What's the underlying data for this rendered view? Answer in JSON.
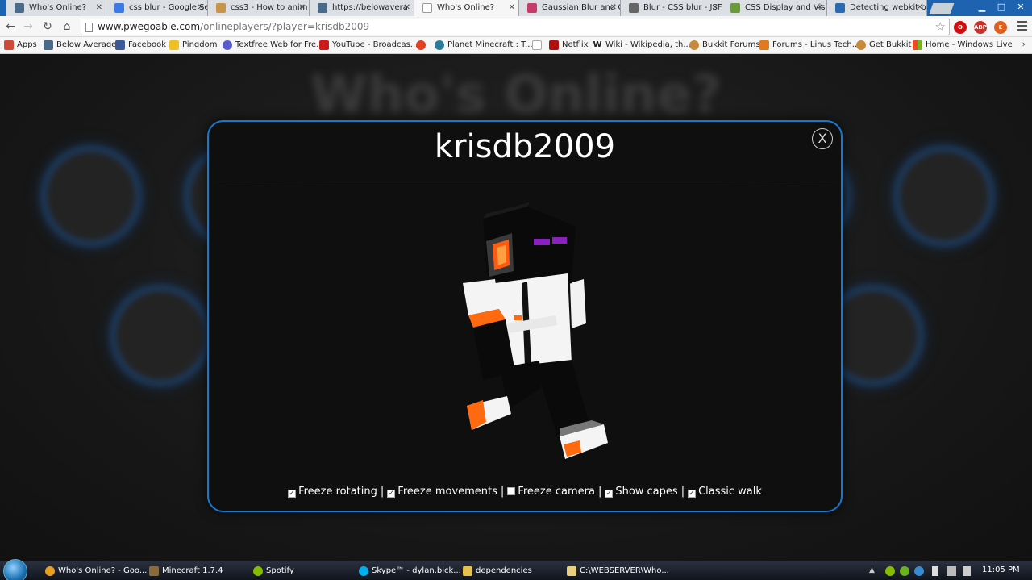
{
  "browser": {
    "tabs": [
      {
        "title": "Who's Online?",
        "color": "#4a6a8a"
      },
      {
        "title": "css blur - Google Se",
        "color": "#3b7be8"
      },
      {
        "title": "css3 - How to anim",
        "color": "#c8944a"
      },
      {
        "title": "https://belowavera",
        "color": "#4a6a8a"
      },
      {
        "title": "Who's Online?",
        "color": "#ffffff",
        "active": true
      },
      {
        "title": "Gaussian Blur and C",
        "color": "#c83a6a"
      },
      {
        "title": "Blur - CSS blur - JSF",
        "color": "#666666"
      },
      {
        "title": "CSS Display and Visi",
        "color": "#6a9a3a"
      },
      {
        "title": "Detecting webkit br",
        "color": "#2a6ab0"
      }
    ],
    "url_host": "www.pwegoable.com",
    "url_path": "/onlineplayers/?player=krisdb2009",
    "window_controls": {
      "minimize": "▁",
      "maximize": "□",
      "close": "✕"
    },
    "extensions": [
      "O",
      "ABP",
      "E"
    ]
  },
  "bookmarks": [
    {
      "label": "Apps",
      "color": "#d04a3a"
    },
    {
      "label": "Below Average",
      "color": "#4a6a8a"
    },
    {
      "label": "Facebook",
      "color": "#3b5998"
    },
    {
      "label": "Pingdom",
      "color": "#f0c020"
    },
    {
      "label": "Textfree Web for Fre...",
      "color": "#5a5ad0"
    },
    {
      "label": "YouTube - Broadcas...",
      "color": "#cc1a1a"
    },
    {
      "label": "",
      "color": "#e04020"
    },
    {
      "label": "Planet Minecraft : T...",
      "color": "#2a7a9a"
    },
    {
      "label": "",
      "color": "#dddddd"
    },
    {
      "label": "Netflix",
      "color": "#b01010"
    },
    {
      "label": "Wiki - Wikipedia, th...",
      "color": "#ffffff"
    },
    {
      "label": "Bukkit Forums",
      "color": "#c88a3a"
    },
    {
      "label": "Forums - Linus Tech...",
      "color": "#e07a20"
    },
    {
      "label": "Get Bukkit",
      "color": "#c88a3a"
    },
    {
      "label": "Home - Windows Live",
      "color": "#f0a020"
    }
  ],
  "page": {
    "background_title": "Who's Online?",
    "modal": {
      "player_name": "krisdb2009",
      "close_label": "X",
      "options": [
        {
          "label": "Freeze rotating",
          "checked": true
        },
        {
          "label": "Freeze movements",
          "checked": true
        },
        {
          "label": "Freeze camera",
          "checked": false
        },
        {
          "label": "Show capes",
          "checked": true
        },
        {
          "label": "Classic walk",
          "checked": true
        }
      ]
    },
    "accent_color": "#1878d0"
  },
  "taskbar": {
    "items": [
      {
        "label": "Who's Online? - Goo...",
        "color": "#e8a020"
      },
      {
        "label": "Minecraft 1.7.4",
        "color": "#8a6a3a"
      },
      {
        "label": "Spotify",
        "color": "#84bd00"
      },
      {
        "label": "Skype™ - dylan.bick...",
        "color": "#00aff0"
      },
      {
        "label": "dependencies",
        "color": "#e8c050"
      },
      {
        "label": "C:\\WEBSERVER\\Who...",
        "color": "#e8d080"
      }
    ],
    "clock": "11:05 PM"
  }
}
